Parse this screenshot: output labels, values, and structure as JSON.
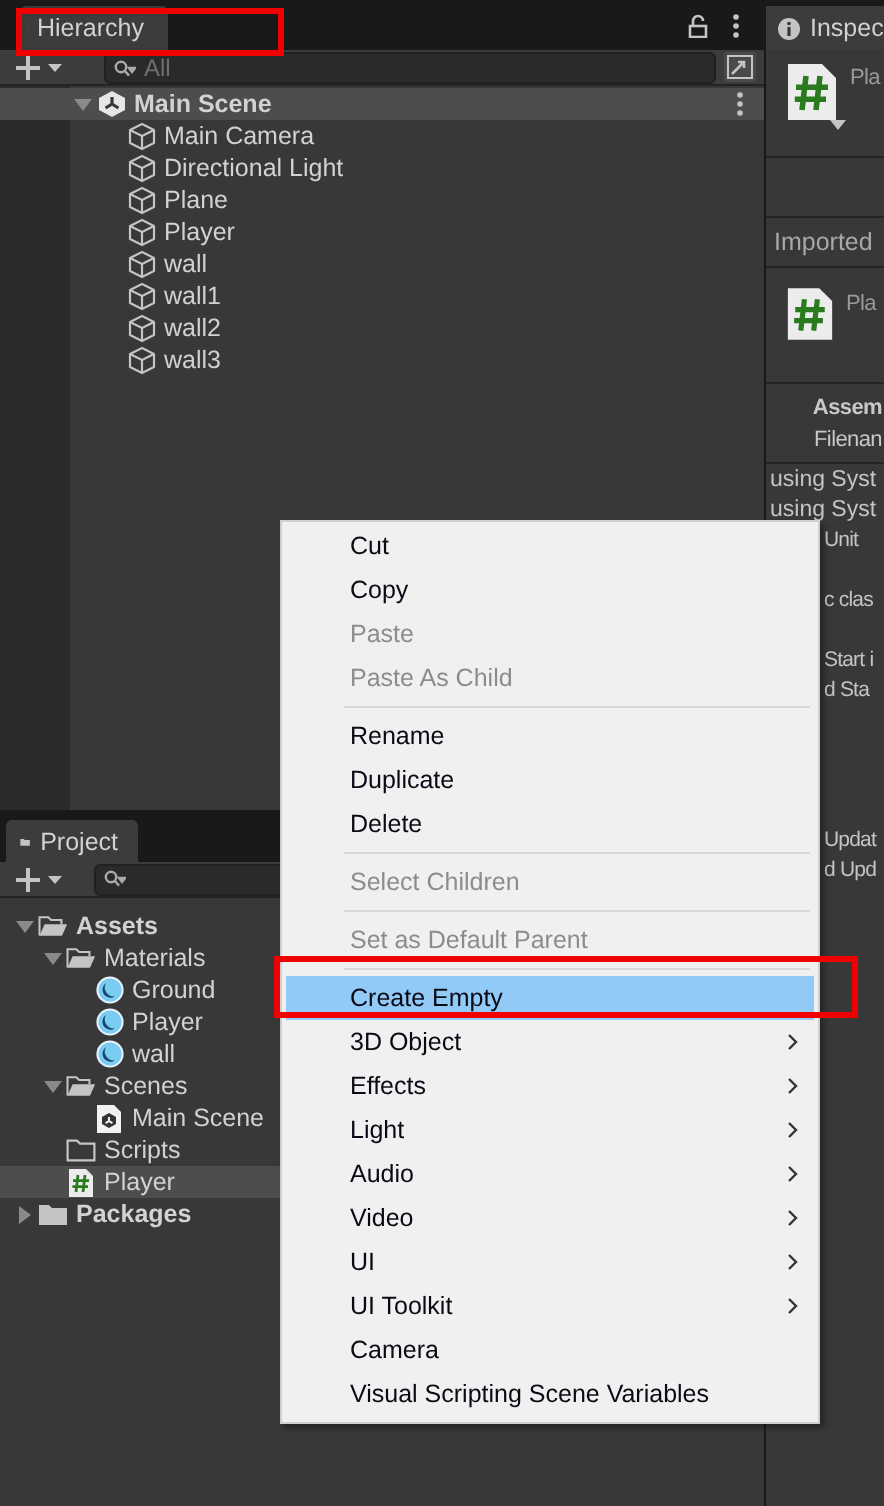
{
  "hierarchy": {
    "tab": "Hierarchy",
    "search": {
      "placeholder": "All"
    },
    "tree": [
      {
        "label": "Main Scene",
        "kind": "scene",
        "expanded": true,
        "children": [
          {
            "label": "Main Camera",
            "kind": "object"
          },
          {
            "label": "Directional Light",
            "kind": "object"
          },
          {
            "label": "Plane",
            "kind": "object"
          },
          {
            "label": "Player",
            "kind": "object"
          },
          {
            "label": "wall",
            "kind": "object"
          },
          {
            "label": "wall1",
            "kind": "object"
          },
          {
            "label": "wall2",
            "kind": "object"
          },
          {
            "label": "wall3",
            "kind": "object"
          }
        ]
      }
    ]
  },
  "inspector": {
    "tab": "Inspec",
    "header_name": "Pla",
    "section": "Imported",
    "asset_name": "Pla",
    "fields": [
      {
        "text": "Assem",
        "kind": "heading"
      },
      {
        "text": "Filenan",
        "kind": "field"
      }
    ],
    "code_lines": [
      {
        "text": "using Syst",
        "kind": "line"
      },
      {
        "text": "using Syst",
        "kind": "line"
      },
      {
        "text": "Unit",
        "kind": "covered"
      },
      {
        "kind": "gap"
      },
      {
        "text": "c clas",
        "kind": "covered"
      },
      {
        "kind": "gap"
      },
      {
        "text": "Start i",
        "kind": "covered"
      },
      {
        "text": "d Sta",
        "kind": "covered"
      },
      {
        "kind": "gap"
      },
      {
        "kind": "gap"
      },
      {
        "kind": "gap"
      },
      {
        "kind": "gap"
      },
      {
        "text": "Updat",
        "kind": "covered"
      },
      {
        "text": "d Upd",
        "kind": "covered"
      }
    ]
  },
  "project": {
    "tab": "Project",
    "tree": [
      {
        "label": "Assets",
        "kind": "folder",
        "expanded": true,
        "selected": false,
        "children": [
          {
            "label": "Materials",
            "kind": "folder",
            "expanded": true,
            "selected": false,
            "children": [
              {
                "label": "Ground",
                "kind": "material",
                "selected": false
              },
              {
                "label": "Player",
                "kind": "material",
                "selected": false
              },
              {
                "label": "wall",
                "kind": "material",
                "selected": false
              }
            ]
          },
          {
            "label": "Scenes",
            "kind": "folder",
            "expanded": true,
            "selected": false,
            "children": [
              {
                "label": "Main Scene",
                "kind": "scene",
                "selected": false
              }
            ]
          },
          {
            "label": "Scripts",
            "kind": "folder",
            "selected": false
          },
          {
            "label": "Player",
            "kind": "script",
            "selected": true
          }
        ]
      },
      {
        "label": "Packages",
        "kind": "folder",
        "expanded": false,
        "selected": false
      }
    ]
  },
  "context_menu": {
    "items": [
      {
        "kind": "item",
        "label": "Cut",
        "disabled": false,
        "selected": false,
        "submenu": false
      },
      {
        "kind": "item",
        "label": "Copy",
        "disabled": false,
        "selected": false,
        "submenu": false
      },
      {
        "kind": "item",
        "label": "Paste",
        "disabled": true,
        "selected": false,
        "submenu": false
      },
      {
        "kind": "item",
        "label": "Paste As Child",
        "disabled": true,
        "selected": false,
        "submenu": false
      },
      {
        "kind": "separator"
      },
      {
        "kind": "item",
        "label": "Rename",
        "disabled": false,
        "selected": false,
        "submenu": false
      },
      {
        "kind": "item",
        "label": "Duplicate",
        "disabled": false,
        "selected": false,
        "submenu": false
      },
      {
        "kind": "item",
        "label": "Delete",
        "disabled": false,
        "selected": false,
        "submenu": false
      },
      {
        "kind": "separator"
      },
      {
        "kind": "item",
        "label": "Select Children",
        "disabled": true,
        "selected": false,
        "submenu": false
      },
      {
        "kind": "separator"
      },
      {
        "kind": "item",
        "label": "Set as Default Parent",
        "disabled": true,
        "selected": false,
        "submenu": false
      },
      {
        "kind": "separator"
      },
      {
        "kind": "item",
        "label": "Create Empty",
        "disabled": false,
        "selected": true,
        "submenu": false
      },
      {
        "kind": "item",
        "label": "3D Object",
        "disabled": false,
        "selected": false,
        "submenu": true
      },
      {
        "kind": "item",
        "label": "Effects",
        "disabled": false,
        "selected": false,
        "submenu": true
      },
      {
        "kind": "item",
        "label": "Light",
        "disabled": false,
        "selected": false,
        "submenu": true
      },
      {
        "kind": "item",
        "label": "Audio",
        "disabled": false,
        "selected": false,
        "submenu": true
      },
      {
        "kind": "item",
        "label": "Video",
        "disabled": false,
        "selected": false,
        "submenu": true
      },
      {
        "kind": "item",
        "label": "UI",
        "disabled": false,
        "selected": false,
        "submenu": true
      },
      {
        "kind": "item",
        "label": "UI Toolkit",
        "disabled": false,
        "selected": false,
        "submenu": true
      },
      {
        "kind": "item",
        "label": "Camera",
        "disabled": false,
        "selected": false,
        "submenu": false
      },
      {
        "kind": "item",
        "label": "Visual Scripting Scene Variables",
        "disabled": false,
        "selected": false,
        "submenu": false
      }
    ]
  }
}
